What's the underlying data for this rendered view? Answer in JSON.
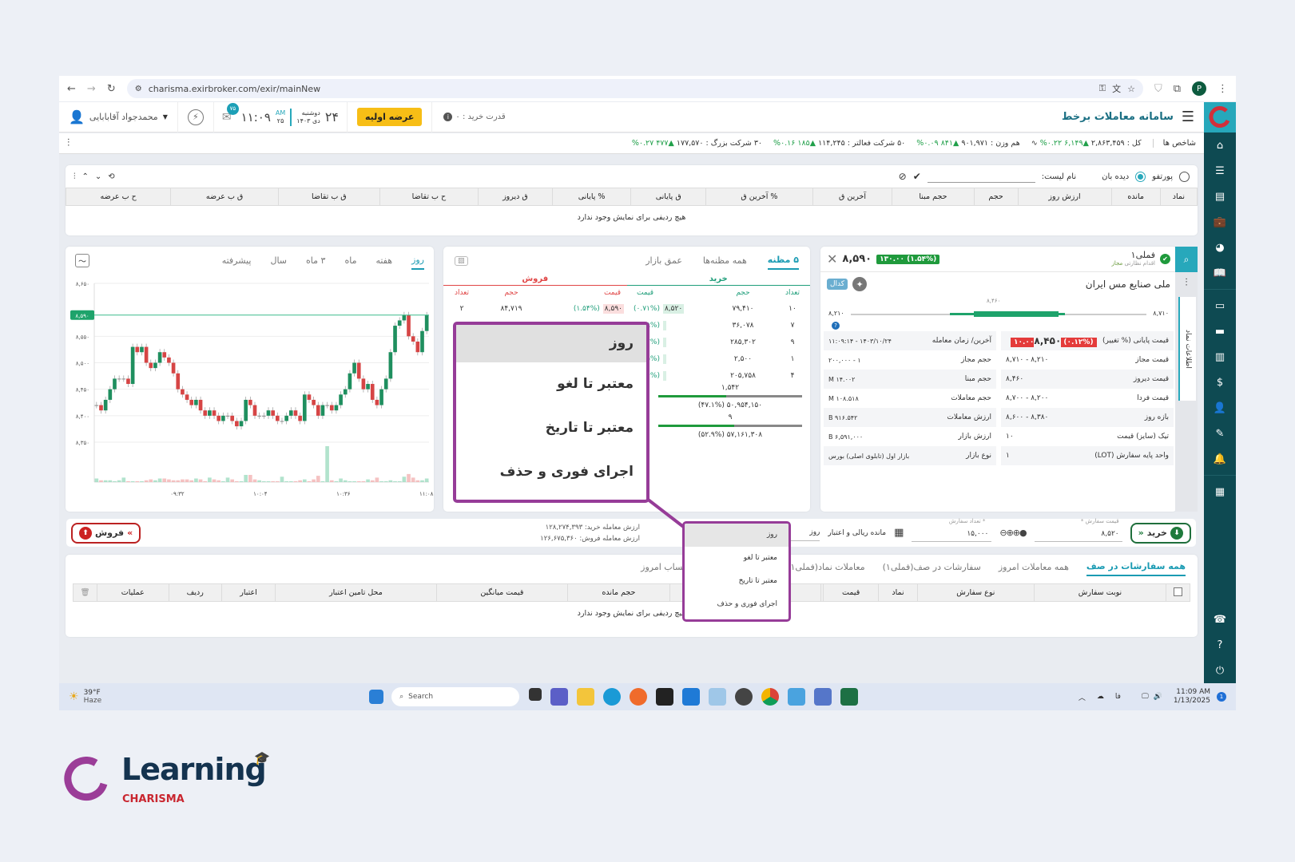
{
  "browser": {
    "url": "charisma.exirbroker.com/exir/mainNew",
    "profile": "P"
  },
  "header": {
    "title": "سامانه معاملات برخط",
    "buying_power": "قدرت خرید : ۰",
    "ipo_button": "عرضه اولیه",
    "day": "۲۴",
    "weekday": "دوشنبه",
    "month_year": "دی ۱۴۰۳",
    "time": "۱۱:۰۹",
    "ampm": "AM",
    "seconds": "۲۵",
    "messages_badge": "۷۵",
    "user": "محمدجواد آقابابایی"
  },
  "indices": {
    "label": "شاخص ها",
    "items": [
      {
        "text": "کل : ۲,۸۶۳,۴۵۹",
        "change": "▲۶,۱۴۹ ۰.۲۲%"
      },
      {
        "text": "هم وزن : ۹۰۱,۹۷۱",
        "change": "▲۸۴۱ ۰.۰۹%"
      },
      {
        "text": "۵۰ شرکت فعالتر : ۱۱۴,۲۴۵",
        "change": "▲۱۸۵ ۰.۱۶%"
      },
      {
        "text": "۳۰ شرکت بزرگ : ۱۷۷,۵۷۰",
        "change": "▲۴۷۷ ۰.۲۷%"
      }
    ]
  },
  "watchlist": {
    "radio_portfolio": "پورتفو",
    "radio_watch": "دیده بان",
    "list_name_label": "نام لیست:",
    "list_name_value": "",
    "columns": [
      "نماد",
      "مانده",
      "ارزش روز",
      "حجم",
      "حجم مبنا",
      "آخرین ق",
      "% آخرین ق",
      "ق پایانی",
      "% پایانی",
      "ق دیروز",
      "ح ب تقاضا",
      "ق ب تقاضا",
      "ق ب عرضه",
      "ح ب عرضه"
    ],
    "empty": "هیچ ردیفی برای نمایش وجود ندارد"
  },
  "symbol": {
    "ticker": "فملی۱",
    "status": "اقدام نظارتی",
    "permission": "مجاز",
    "last_price": "۸,۵۹۰",
    "change": "(۱.۵۴%) ۱۳۰.۰۰",
    "name": "ملی صنایع مس ایران",
    "codal": "کدال",
    "range_low": "۸,۲۱۰",
    "range_high": "۸,۷۱۰",
    "range_ref": "۸,۴۶۰",
    "side_tab": "اطلاعات نماد",
    "close_price": "۸,۴۵۰",
    "close_change": "(۰.۱۲%) ۱۰.۰۰",
    "rows": [
      {
        "l1": "قیمت پایانی (% تغییر)",
        "v1": "",
        "l2": "آخرین/ زمان معامله",
        "v2": "۱۴۰۳/۱۰/۲۴ - ۱۱:۰۹:۱۴"
      },
      {
        "l1": "قیمت مجاز",
        "v1": "۸,۲۱۰ - ۸,۷۱۰",
        "l2": "حجم مجاز",
        "v2": "۱ - ۲۰۰,۰۰۰"
      },
      {
        "l1": "قیمت دیروز",
        "v1": "۸,۴۶۰",
        "l2": "حجم مبنا",
        "v2": "۱۴.۰۰۲ M"
      },
      {
        "l1": "قیمت فردا",
        "v1": "۸,۲۰۰ - ۸,۷۰۰",
        "l2": "حجم معاملات",
        "v2": "۱۰۸.۵۱۸ M"
      },
      {
        "l1": "بازه روز",
        "v1": "۸,۳۸۰ - ۸,۶۰۰",
        "l2": "ارزش معاملات",
        "v2": "۹۱۶.۵۴۲ B"
      },
      {
        "l1": "تیک (سایز) قیمت",
        "v1": "۱۰",
        "l2": "ارزش بازار",
        "v2": "۶,۵۹۱,۰۰۰ B"
      },
      {
        "l1": "واحد پایه سفارش (LOT)",
        "v1": "۱",
        "l2": "نوع بازار",
        "v2": "بازار اول (تابلوی اصلی) بورس"
      }
    ]
  },
  "orderbook": {
    "tabs": [
      "۵ مظنه",
      "همه مظنه‌ها",
      "عمق بازار"
    ],
    "buy_title": "خرید",
    "sell_title": "فروش",
    "buy_cols": [
      "تعداد",
      "حجم",
      "قیمت"
    ],
    "sell_cols": [
      "قیمت",
      "حجم",
      "تعداد"
    ],
    "buy": [
      {
        "count": "۱۰",
        "vol": "۷۹,۴۱۰",
        "price": "۸,۵۲۰",
        "pct": "(۰.۷۱%)"
      },
      {
        "count": "۷",
        "vol": "۳۶,۰۷۸",
        "price": "",
        "pct": "(۰.۵۹%)"
      },
      {
        "count": "۹",
        "vol": "۲۸۵,۳۰۲",
        "price": "",
        "pct": "(۰.۴۷%)"
      },
      {
        "count": "۱",
        "vol": "۲,۵۰۰",
        "price": "",
        "pct": "(۰.۳۵%)"
      },
      {
        "count": "۴",
        "vol": "۲۰۵,۷۵۸",
        "price": "",
        "pct": "(۰.۲۴%)"
      }
    ],
    "sell": [
      {
        "price": "۸,۵۹۰",
        "pct": "(۱.۵۴%)",
        "vol": "۸۴,۷۱۹",
        "count": "۲"
      }
    ],
    "summary": [
      "۱,۵۴۲",
      "۵۰,۹۵۴,۱۵۰ (۴۷.۱%)",
      "۹",
      "۵۷,۱۶۱,۳۰۸ (۵۲.۹%)"
    ],
    "buy_share_pct": 47.1,
    "buy_count_share_pct": 53
  },
  "chart_tabs": [
    "روز",
    "هفته",
    "ماه",
    "۳ ماه",
    "سال",
    "پیشرفته"
  ],
  "chart_data": {
    "type": "candlestick",
    "y_ticks": [
      "۸,۳۵۰",
      "۸,۴۰۰",
      "۸,۴۵۰",
      "۸,۵۰۰",
      "۸,۵۵۰",
      "۸,۶۵۰"
    ],
    "y_tick_values": [
      8350,
      8400,
      8450,
      8500,
      8550,
      8650
    ],
    "ylim": [
      8330,
      8660
    ],
    "x_ticks": [
      "۰۹:۳۲",
      "۱۰:۰۴",
      "۱۰:۳۶",
      "۱۱:۰۸"
    ],
    "x_tick_values": [
      "09:32",
      "10:04",
      "10:36",
      "11:08"
    ],
    "x_range": [
      "09:00",
      "11:09"
    ],
    "last_price_label": "۸,۵۹۰",
    "last_price": 8590,
    "closes": [
      8420,
      8410,
      8430,
      8450,
      8470,
      8470,
      8470,
      8460,
      8530,
      8520,
      8530,
      8500,
      8490,
      8500,
      8520,
      8510,
      8500,
      8480,
      8450,
      8440,
      8430,
      8420,
      8430,
      8410,
      8400,
      8410,
      8400,
      8390,
      8400,
      8400,
      8390,
      8380,
      8390,
      8430,
      8420,
      8400,
      8400,
      8400,
      8410,
      8400,
      8390,
      8390,
      8400,
      8410,
      8400,
      8390,
      8440,
      8430,
      8420,
      8400,
      8420,
      8420,
      8410,
      8420,
      8440,
      8450,
      8480,
      8500,
      8470,
      8450,
      8460,
      8430,
      8420,
      8450,
      8470,
      8520,
      8570,
      8580,
      8590,
      8550,
      8540,
      8520,
      8560,
      8590
    ],
    "volumes": [
      4,
      2,
      2,
      2,
      1,
      2,
      5,
      1,
      1,
      1,
      1,
      2,
      3,
      2,
      4,
      4,
      3,
      2,
      2,
      3,
      3,
      2,
      4,
      3,
      1,
      5,
      3,
      2,
      1,
      5,
      3,
      1,
      1,
      8,
      8,
      3,
      2,
      1,
      1,
      1,
      1,
      6,
      1,
      1,
      1,
      2,
      3,
      1,
      3,
      7,
      1,
      40,
      2,
      1,
      4,
      2,
      1,
      1,
      1,
      1,
      3,
      2,
      5,
      1,
      1,
      2,
      1,
      1,
      6,
      9,
      5,
      2,
      2,
      4
    ],
    "colors": {
      "up": "#1f8f5f",
      "down": "#d64545",
      "line": "#3dbb8c"
    }
  },
  "order_entry": {
    "buy_button": "خرید",
    "sell_button": "فروش",
    "price_label": "قیمت سفارش *",
    "price_value": "۸,۵۲۰",
    "qty_label": "* تعداد سفارش",
    "qty_value": "۱۵,۰۰۰",
    "balance_label": "مانده ریالی و اعتبار",
    "validity_value": "روز",
    "buy_value_label": "ارزش معامله خرید:",
    "buy_value": "۱۲۸,۲۷۴,۳۹۳",
    "sell_value_label": "ارزش معامله فروش:",
    "sell_value": "۱۲۶,۶۷۵,۳۶۰"
  },
  "orders": {
    "tabs": [
      "همه سفارشات در صف",
      "همه معاملات امروز",
      "سفارشات در صف(فملی۱)",
      "معاملات نماد(فملی۱)",
      "سفارشات",
      "گردش حساب امروز"
    ],
    "columns": [
      "نوبت سفارش",
      "نوع سفارش",
      "نماد",
      "قیمت",
      "",
      "حجم انجام شده",
      "حجم مانده",
      "قیمت میانگین",
      "محل تامین اعتبار",
      "اعتبار",
      "ردیف",
      "عملیات"
    ],
    "empty": "هیچ ردیفی برای نمایش وجود ندارد"
  },
  "validity_popup": {
    "items": [
      "روز",
      "معتبر تا لغو",
      "معتبر تا تاریخ",
      "اجرای فوری و حذف"
    ],
    "selected": "روز",
    "highlight_color": "#963c98"
  },
  "taskbar": {
    "weather_temp": "39°F",
    "weather_desc": "Haze",
    "search": "Search",
    "time": "11:09 AM",
    "date": "1/13/2025"
  },
  "brand": {
    "learning": "Learning",
    "charisma": "CHARISMA"
  }
}
